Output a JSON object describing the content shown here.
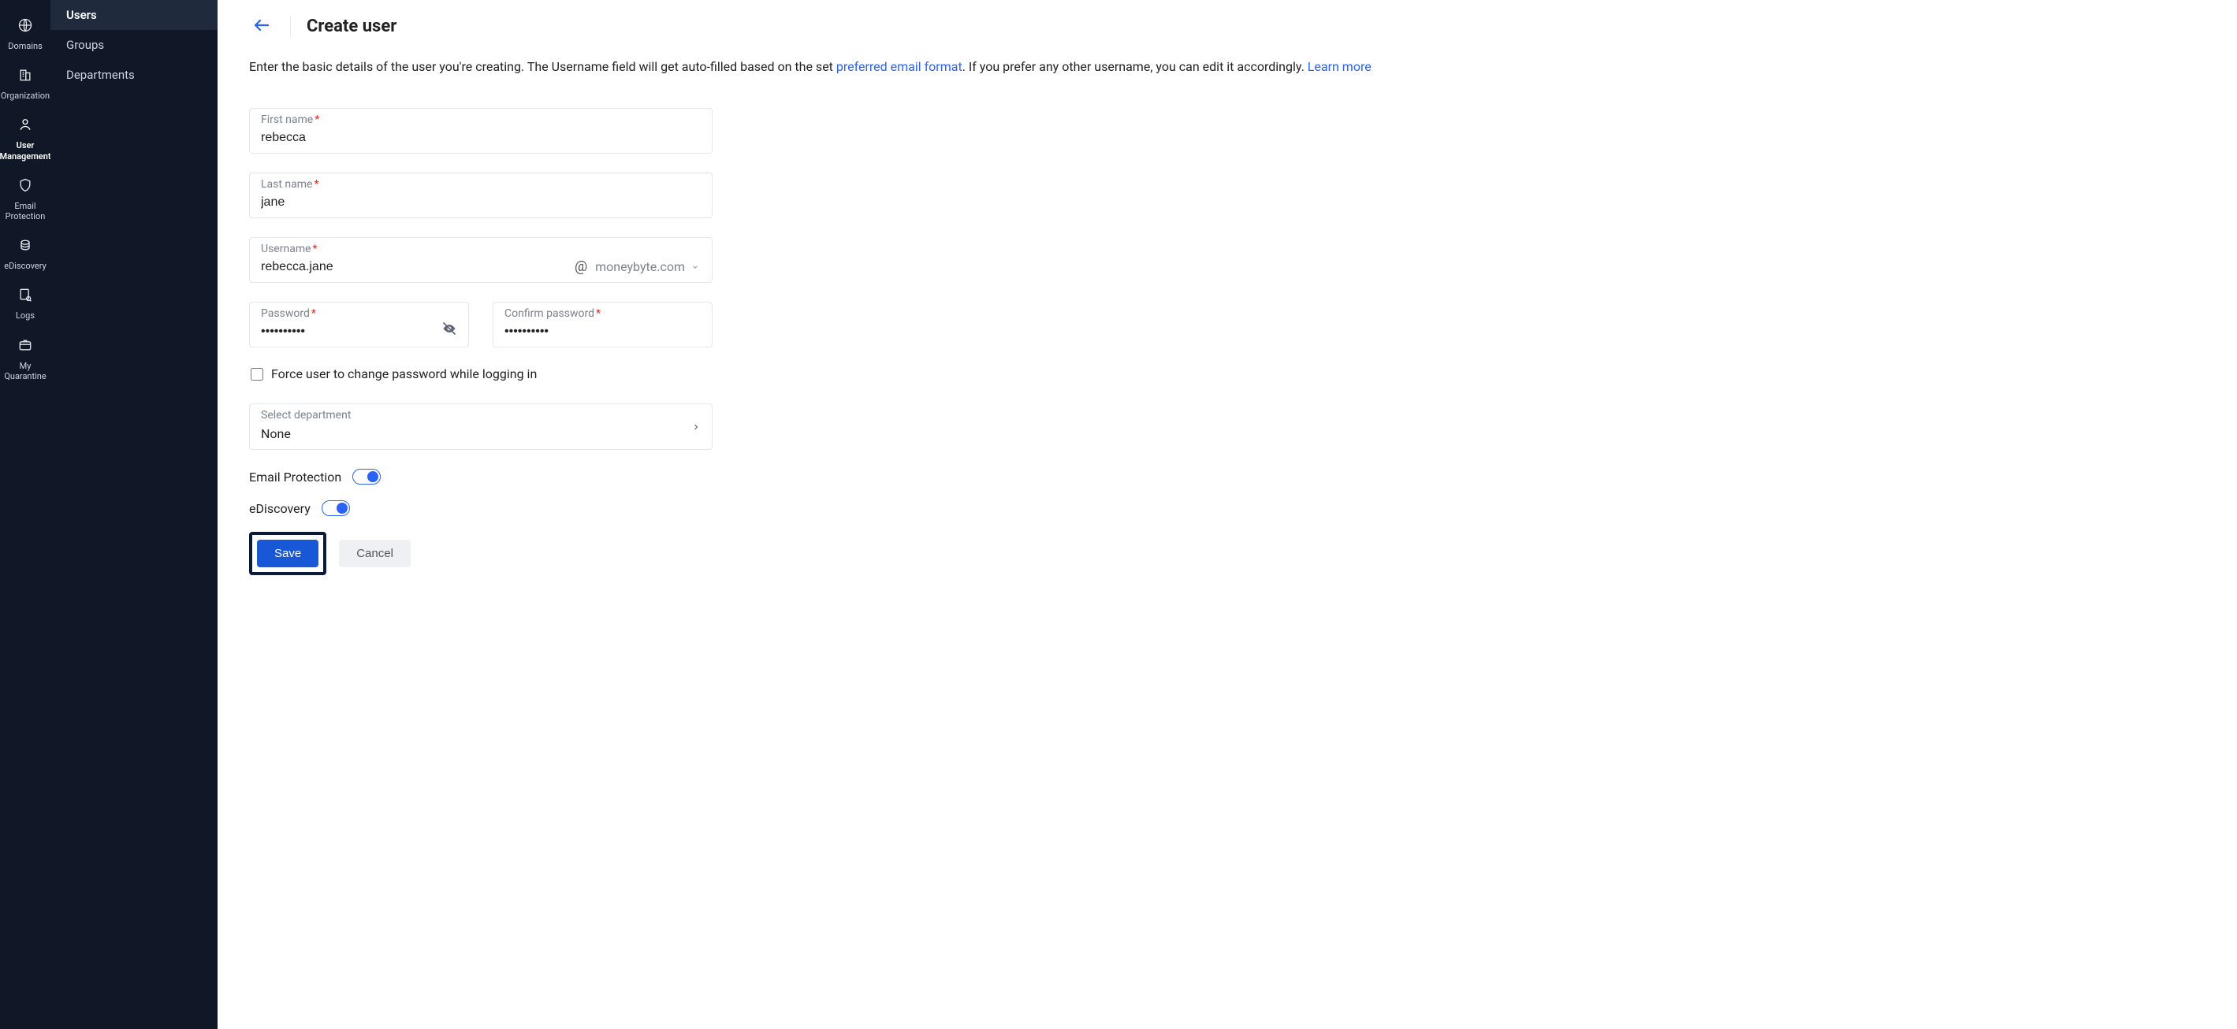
{
  "rail": {
    "items": [
      {
        "label": "Domains"
      },
      {
        "label": "Organization"
      },
      {
        "label": "User Management"
      },
      {
        "label": "Email Protection"
      },
      {
        "label": "eDiscovery"
      },
      {
        "label": "Logs"
      },
      {
        "label": "My Quarantine"
      }
    ]
  },
  "subnav": {
    "items": [
      {
        "label": "Users"
      },
      {
        "label": "Groups"
      },
      {
        "label": "Departments"
      }
    ]
  },
  "header": {
    "title": "Create user"
  },
  "intro": {
    "prefix": "Enter the basic details of the user you're creating. The Username field will get auto-filled based on the set ",
    "link1": "preferred email format",
    "middle": ". If you prefer any other username, you can edit it accordingly. ",
    "link2": "Learn more"
  },
  "form": {
    "first_name_label": "First name",
    "first_name_value": "rebecca",
    "last_name_label": "Last name",
    "last_name_value": "jane",
    "username_label": "Username",
    "username_value": "rebecca.jane",
    "at": "@",
    "domain": "moneybyte.com",
    "password_label": "Password",
    "password_value": "••••••••••",
    "confirm_label": "Confirm password",
    "confirm_value": "••••••••••",
    "force_change_label": "Force user to change password while logging in",
    "department_label": "Select department",
    "department_value": "None",
    "email_protection_label": "Email Protection",
    "ediscovery_label": "eDiscovery",
    "save": "Save",
    "cancel": "Cancel",
    "required_mark": "*"
  }
}
